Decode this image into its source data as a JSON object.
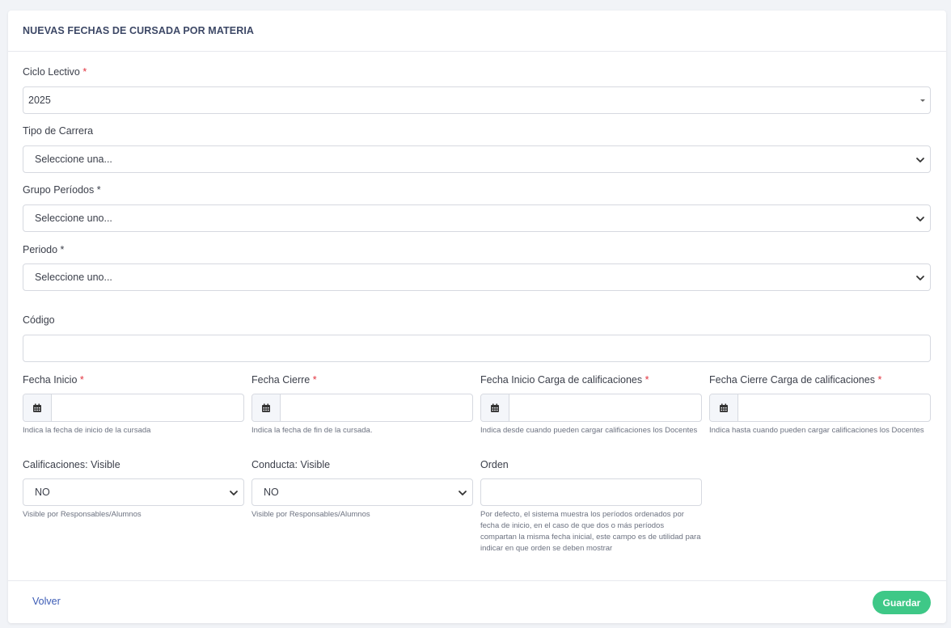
{
  "header": {
    "title": "NUEVAS FECHAS DE CURSADA POR MATERIA"
  },
  "form": {
    "ciclo": {
      "label": "Ciclo Lectivo",
      "required": "*",
      "value": "2025"
    },
    "tipo_carrera": {
      "label": "Tipo de Carrera",
      "value": "Seleccione una..."
    },
    "grupo": {
      "label": "Grupo Períodos *",
      "value": "Seleccione uno..."
    },
    "periodo": {
      "label": "Periodo *",
      "value": "Seleccione uno..."
    },
    "codigo": {
      "label": "Código",
      "value": ""
    },
    "fecha_inicio": {
      "label": "Fecha Inicio",
      "required": "*",
      "value": "",
      "help": "Indica la fecha de inicio de la cursada"
    },
    "fecha_cierre": {
      "label": "Fecha Cierre",
      "required": "*",
      "value": "",
      "help": "Indica la fecha de fin de la cursada."
    },
    "fecha_inicio_carga": {
      "label": "Fecha Inicio Carga de calificaciones",
      "required": "*",
      "value": "",
      "help": "Indica desde cuando pueden cargar calificaciones los Docentes"
    },
    "fecha_cierre_carga": {
      "label": "Fecha Cierre Carga de calificaciones",
      "required": "*",
      "value": "",
      "help": "Indica hasta cuando pueden cargar calificaciones los Docentes"
    },
    "calificaciones_visible": {
      "label": "Calificaciones: Visible",
      "value": "NO",
      "help": "Visible por Responsables/Alumnos"
    },
    "conducta_visible": {
      "label": "Conducta: Visible",
      "value": "NO",
      "help": "Visible por Responsables/Alumnos"
    },
    "orden": {
      "label": "Orden",
      "value": "",
      "help": "Por defecto, el sistema muestra los períodos ordenados por fecha de inicio, en el caso de que dos o más períodos compartan la misma fecha inicial, este campo es de utilidad para indicar en que orden se deben mostrar"
    }
  },
  "footer": {
    "back_label": "Volver",
    "save_label": "Guardar"
  },
  "colors": {
    "accent": "#3ec887",
    "link": "#3b5bb5",
    "required": "#e2333f",
    "title": "#3d4866"
  },
  "icons": {
    "date": "calendar-icon",
    "select": "chevron-down-icon"
  }
}
